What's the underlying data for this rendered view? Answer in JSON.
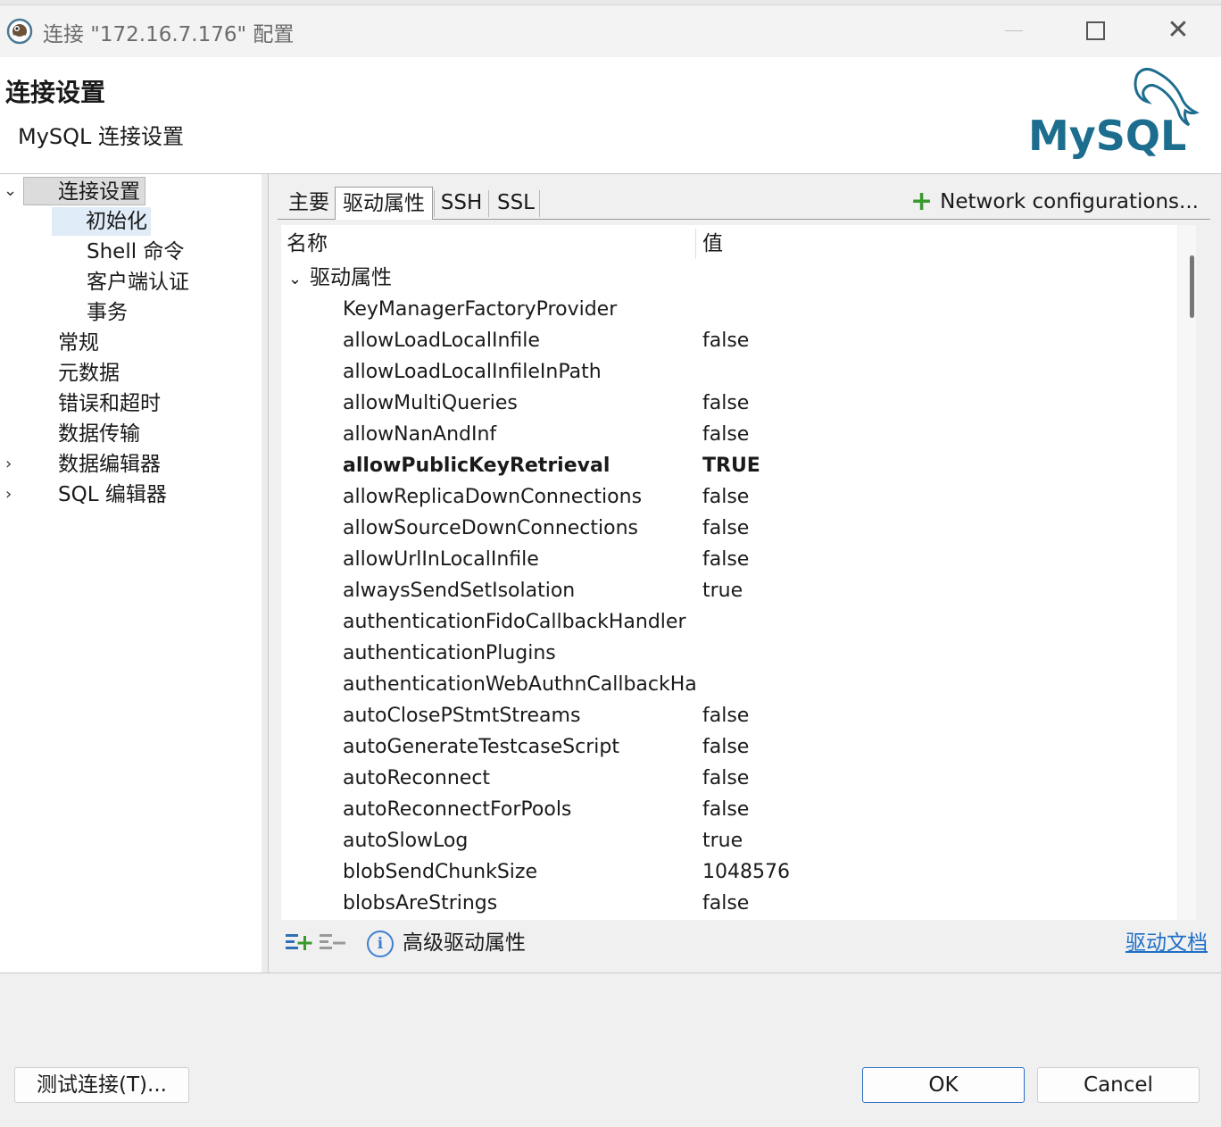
{
  "window": {
    "title": "连接 \"172.16.7.176\" 配置"
  },
  "header": {
    "title": "连接设置",
    "subtitle": "MySQL 连接设置",
    "logo_text": "MySQL"
  },
  "tree": {
    "root": "连接设置",
    "children": [
      "初始化",
      "Shell 命令",
      "客户端认证",
      "事务"
    ],
    "items": [
      "常规",
      "元数据",
      "错误和超时",
      "数据传输",
      "数据编辑器",
      "SQL 编辑器"
    ]
  },
  "tabs": [
    "主要",
    "驱动属性",
    "SSH",
    "SSL"
  ],
  "network_config_label": "Network configurations...",
  "table": {
    "col_name": "名称",
    "col_value": "值",
    "group": "驱动属性",
    "rows": [
      {
        "name": "KeyManagerFactoryProvider",
        "value": ""
      },
      {
        "name": "allowLoadLocalInfile",
        "value": "false"
      },
      {
        "name": "allowLoadLocalInfileInPath",
        "value": ""
      },
      {
        "name": "allowMultiQueries",
        "value": "false"
      },
      {
        "name": "allowNanAndInf",
        "value": "false"
      },
      {
        "name": "allowPublicKeyRetrieval",
        "value": "TRUE",
        "bold": true
      },
      {
        "name": "allowReplicaDownConnections",
        "value": "false"
      },
      {
        "name": "allowSourceDownConnections",
        "value": "false"
      },
      {
        "name": "allowUrlInLocalInfile",
        "value": "false"
      },
      {
        "name": "alwaysSendSetIsolation",
        "value": "true"
      },
      {
        "name": "authenticationFidoCallbackHandler",
        "value": ""
      },
      {
        "name": "authenticationPlugins",
        "value": ""
      },
      {
        "name": "authenticationWebAuthnCallbackHan",
        "value": ""
      },
      {
        "name": "autoClosePStmtStreams",
        "value": "false"
      },
      {
        "name": "autoGenerateTestcaseScript",
        "value": "false"
      },
      {
        "name": "autoReconnect",
        "value": "false"
      },
      {
        "name": "autoReconnectForPools",
        "value": "false"
      },
      {
        "name": "autoSlowLog",
        "value": "true"
      },
      {
        "name": "blobSendChunkSize",
        "value": "1048576"
      },
      {
        "name": "blobsAreStrings",
        "value": "false"
      }
    ]
  },
  "bottom": {
    "advanced_label": "高级驱动属性",
    "doc_link": "驱动文档"
  },
  "buttons": {
    "test": "测试连接(T)...",
    "ok": "OK",
    "cancel": "Cancel"
  }
}
